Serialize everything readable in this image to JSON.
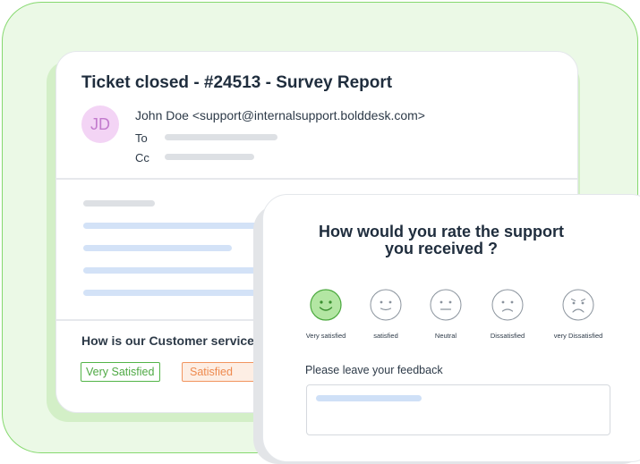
{
  "email": {
    "title": "Ticket closed - #24513 - Survey Report",
    "avatar_initials": "JD",
    "sender": "John Doe <support@internalsupport.bolddesk.com>",
    "to_label": "To",
    "cc_label": "Cc",
    "question": "How is our Customer service ?",
    "chips": [
      "Very Satisfied",
      "Satisfied"
    ]
  },
  "survey": {
    "question_line1": "How would you rate the support",
    "question_line2": "you received ?",
    "ratings": [
      {
        "label": "Very satisfied",
        "face": "happy",
        "selected": true
      },
      {
        "label": "satisfied",
        "face": "smile",
        "selected": false
      },
      {
        "label": "Neutral",
        "face": "neutral",
        "selected": false
      },
      {
        "label": "Dissatisfied",
        "face": "frown",
        "selected": false
      },
      {
        "label": "very Dissatisfied",
        "face": "sad",
        "selected": false
      }
    ],
    "feedback_label": "Please leave your feedback"
  },
  "colors": {
    "accent_green": "#52b447",
    "accent_orange": "#ee8a4f",
    "avatar_bg": "#f3d4f5"
  }
}
